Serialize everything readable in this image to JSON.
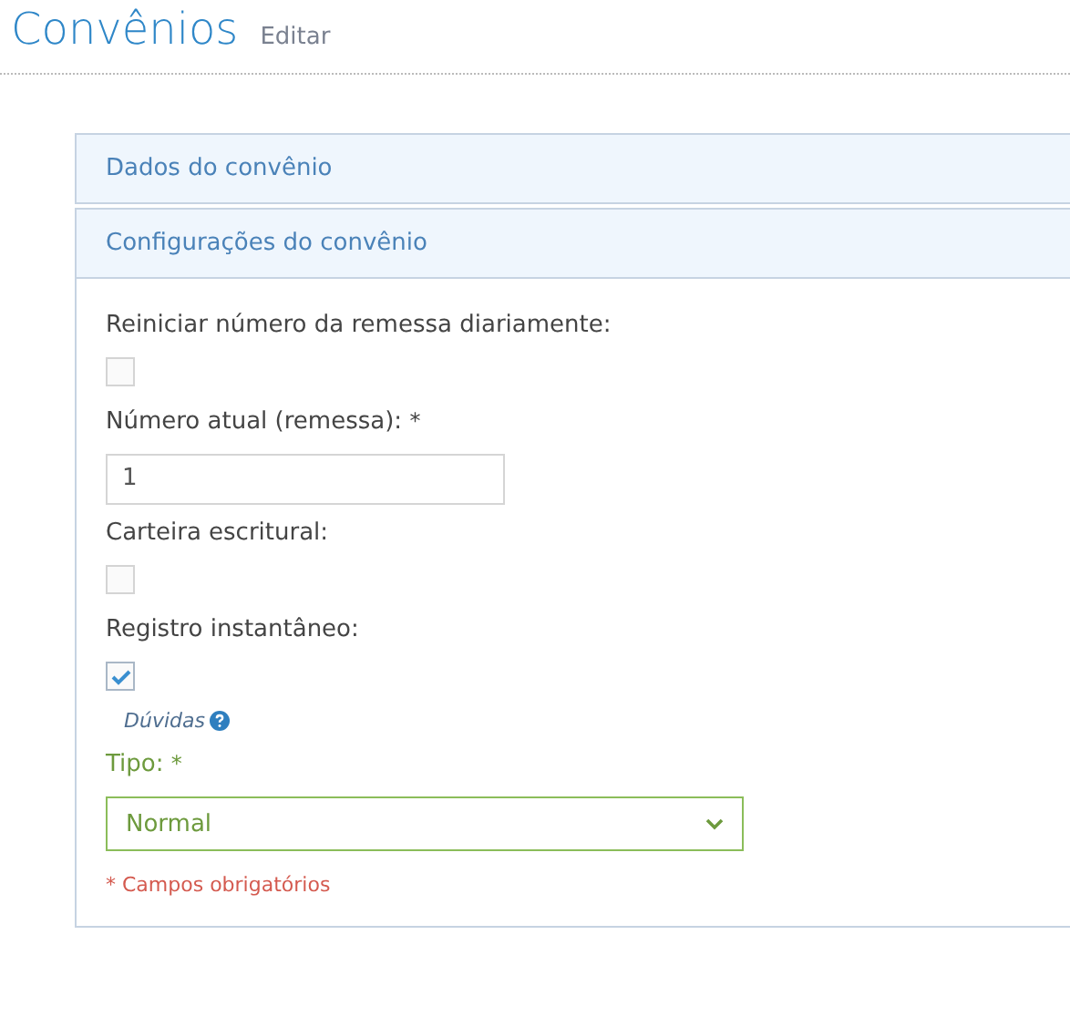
{
  "page": {
    "title": "Convênios",
    "subtitle": "Editar"
  },
  "sections": [
    {
      "title": "Dados do convênio"
    },
    {
      "title": "Configurações do convênio",
      "fields": [
        {
          "kind": "checkbox",
          "label": "Reiniciar número da remessa diariamente:",
          "checked": false
        },
        {
          "kind": "text",
          "label": "Número atual (remessa):",
          "marker": "*",
          "value": "1"
        },
        {
          "kind": "checkbox",
          "label": "Carteira escritural:",
          "checked": false
        },
        {
          "kind": "checkbox",
          "label": "Registro instantâneo:",
          "checked": true,
          "help": "Dúvidas"
        },
        {
          "kind": "select",
          "label": "Tipo:",
          "marker": "*",
          "value": "Normal",
          "valid": true
        }
      ],
      "required_note": "* Campos obrigatórios"
    }
  ]
}
